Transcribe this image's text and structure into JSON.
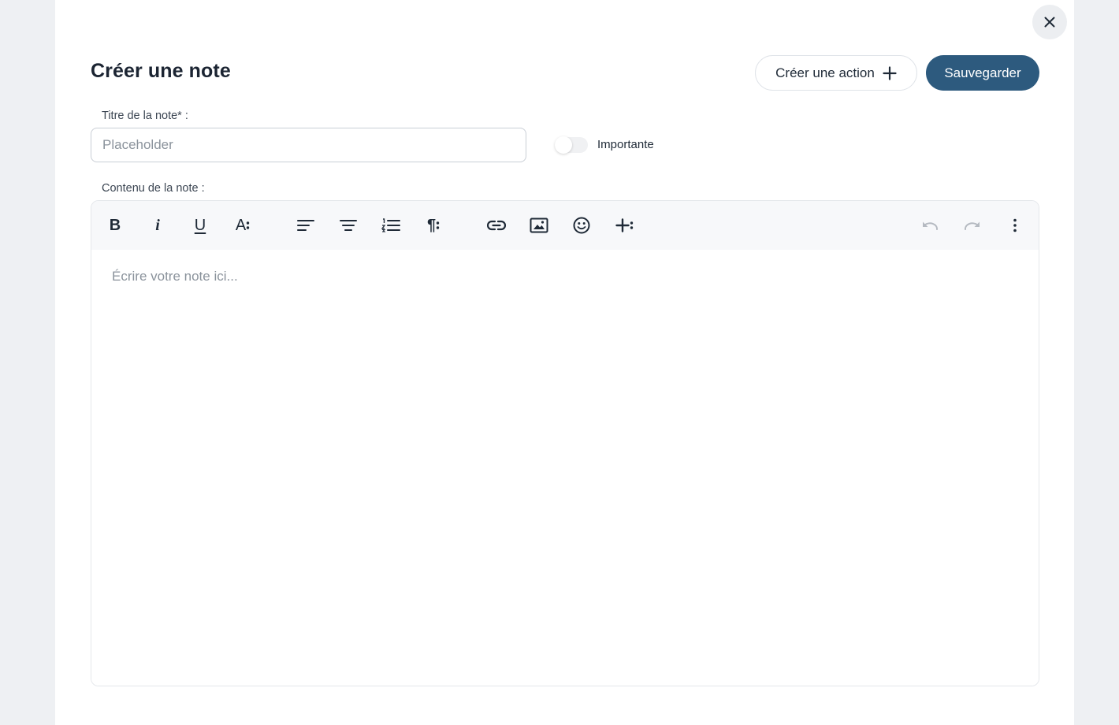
{
  "modal": {
    "title": "Créer une note",
    "create_action_label": "Créer une action",
    "save_label": "Sauvegarder",
    "close_icon": "close-icon"
  },
  "form": {
    "title_label": "Titre de la note* :",
    "title_placeholder": "Placeholder",
    "title_value": "",
    "important_label": "Importante",
    "important_on": false,
    "content_label": "Contenu de la note :",
    "content_placeholder": "Écrire votre note ici..."
  },
  "toolbar": {
    "tools": [
      {
        "name": "bold",
        "icon": "bold-icon"
      },
      {
        "name": "italic",
        "icon": "italic-icon"
      },
      {
        "name": "underline",
        "icon": "underline-icon"
      },
      {
        "name": "font-size",
        "icon": "font-size-menu-icon"
      },
      {
        "name": "align-left",
        "icon": "align-left-icon"
      },
      {
        "name": "align-center",
        "icon": "align-center-icon"
      },
      {
        "name": "ordered-list",
        "icon": "ordered-list-icon"
      },
      {
        "name": "paragraph",
        "icon": "paragraph-menu-icon"
      },
      {
        "name": "link",
        "icon": "link-icon"
      },
      {
        "name": "image",
        "icon": "image-icon"
      },
      {
        "name": "emoji",
        "icon": "emoji-icon"
      },
      {
        "name": "insert",
        "icon": "insert-menu-icon"
      },
      {
        "name": "undo",
        "icon": "undo-icon"
      },
      {
        "name": "redo",
        "icon": "redo-icon"
      },
      {
        "name": "more",
        "icon": "more-vertical-icon"
      }
    ],
    "bold_glyph": "B",
    "italic_glyph": "i",
    "underline_glyph": "U",
    "font_size_glyph": "A",
    "paragraph_glyph": "¶"
  },
  "colors": {
    "primary": "#2d5a7e",
    "background": "#eef0f3",
    "toolbar_bg": "#f7f8fa",
    "placeholder": "#8b939c",
    "disabled_icon": "#b5bac1"
  }
}
